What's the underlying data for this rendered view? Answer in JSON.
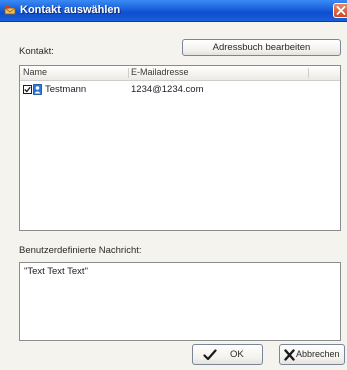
{
  "window": {
    "title": "Kontakt auswählen"
  },
  "contact_section": {
    "label": "Kontakt:",
    "edit_address_book_label": "Adressbuch bearbeiten"
  },
  "contacts_table": {
    "columns": [
      "Name",
      "E-Mailadresse"
    ],
    "rows": [
      {
        "checked": true,
        "name": "Testmann",
        "email": "1234@1234.com"
      }
    ]
  },
  "message_section": {
    "label": "Benutzerdefinierte Nachricht:",
    "value": "\"Text Text Text\""
  },
  "footer": {
    "ok_label": "OK",
    "cancel_label": "Abbrechen"
  },
  "colors": {
    "titlebar": "#1a5fd9",
    "ok_check": "#1a1a1a",
    "cancel_x": "#1a1a1a"
  }
}
